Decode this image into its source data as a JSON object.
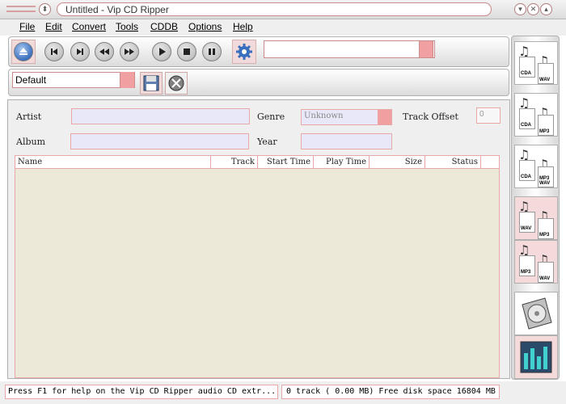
{
  "window": {
    "title": "Untitled - Vip CD Ripper"
  },
  "menu": [
    {
      "label": "File",
      "mnemonic": "F"
    },
    {
      "label": "Edit",
      "mnemonic": "E"
    },
    {
      "label": "Convert",
      "mnemonic": "C"
    },
    {
      "label": "Tools",
      "mnemonic": "T"
    },
    {
      "label": "CDDB",
      "mnemonic": "D"
    },
    {
      "label": "Options",
      "mnemonic": "O"
    },
    {
      "label": "Help",
      "mnemonic": "H"
    }
  ],
  "toolbar": {
    "buttons": [
      "eject-icon",
      "skip-back-icon",
      "skip-forward-icon",
      "rewind-icon",
      "fast-forward-icon",
      "play-icon",
      "stop-icon",
      "pause-icon",
      "settings-gear-icon"
    ],
    "progress_value": ""
  },
  "profile": {
    "value": "Default"
  },
  "info": {
    "artist_label": "Artist",
    "album_label": "Album",
    "genre_label": "Genre",
    "genre_value": "Unknown",
    "year_label": "Year",
    "offset_label": "Track Offset",
    "offset_value": "0"
  },
  "table": {
    "columns": [
      "Name",
      "Track",
      "Start Time",
      "Play Time",
      "Size",
      "Status"
    ]
  },
  "sidebar": [
    {
      "from": "CDA",
      "to": "WAV"
    },
    {
      "from": "CDA",
      "to": "MP3"
    },
    {
      "from": "CDA",
      "to": "MP3 WAV"
    },
    {
      "from": "WAV",
      "to": "MP3"
    },
    {
      "from": "MP3",
      "to": "WAV"
    }
  ],
  "status": {
    "help": "Press F1 for help on the Vip CD Ripper audio CD extr...",
    "info": "0 track ( 0.00 MB) Free disk space 16804 MB"
  },
  "colors": {
    "accent": "#f0a0a0",
    "border_pink": "#e8a8a8",
    "field_bg": "#e8e8f8"
  }
}
